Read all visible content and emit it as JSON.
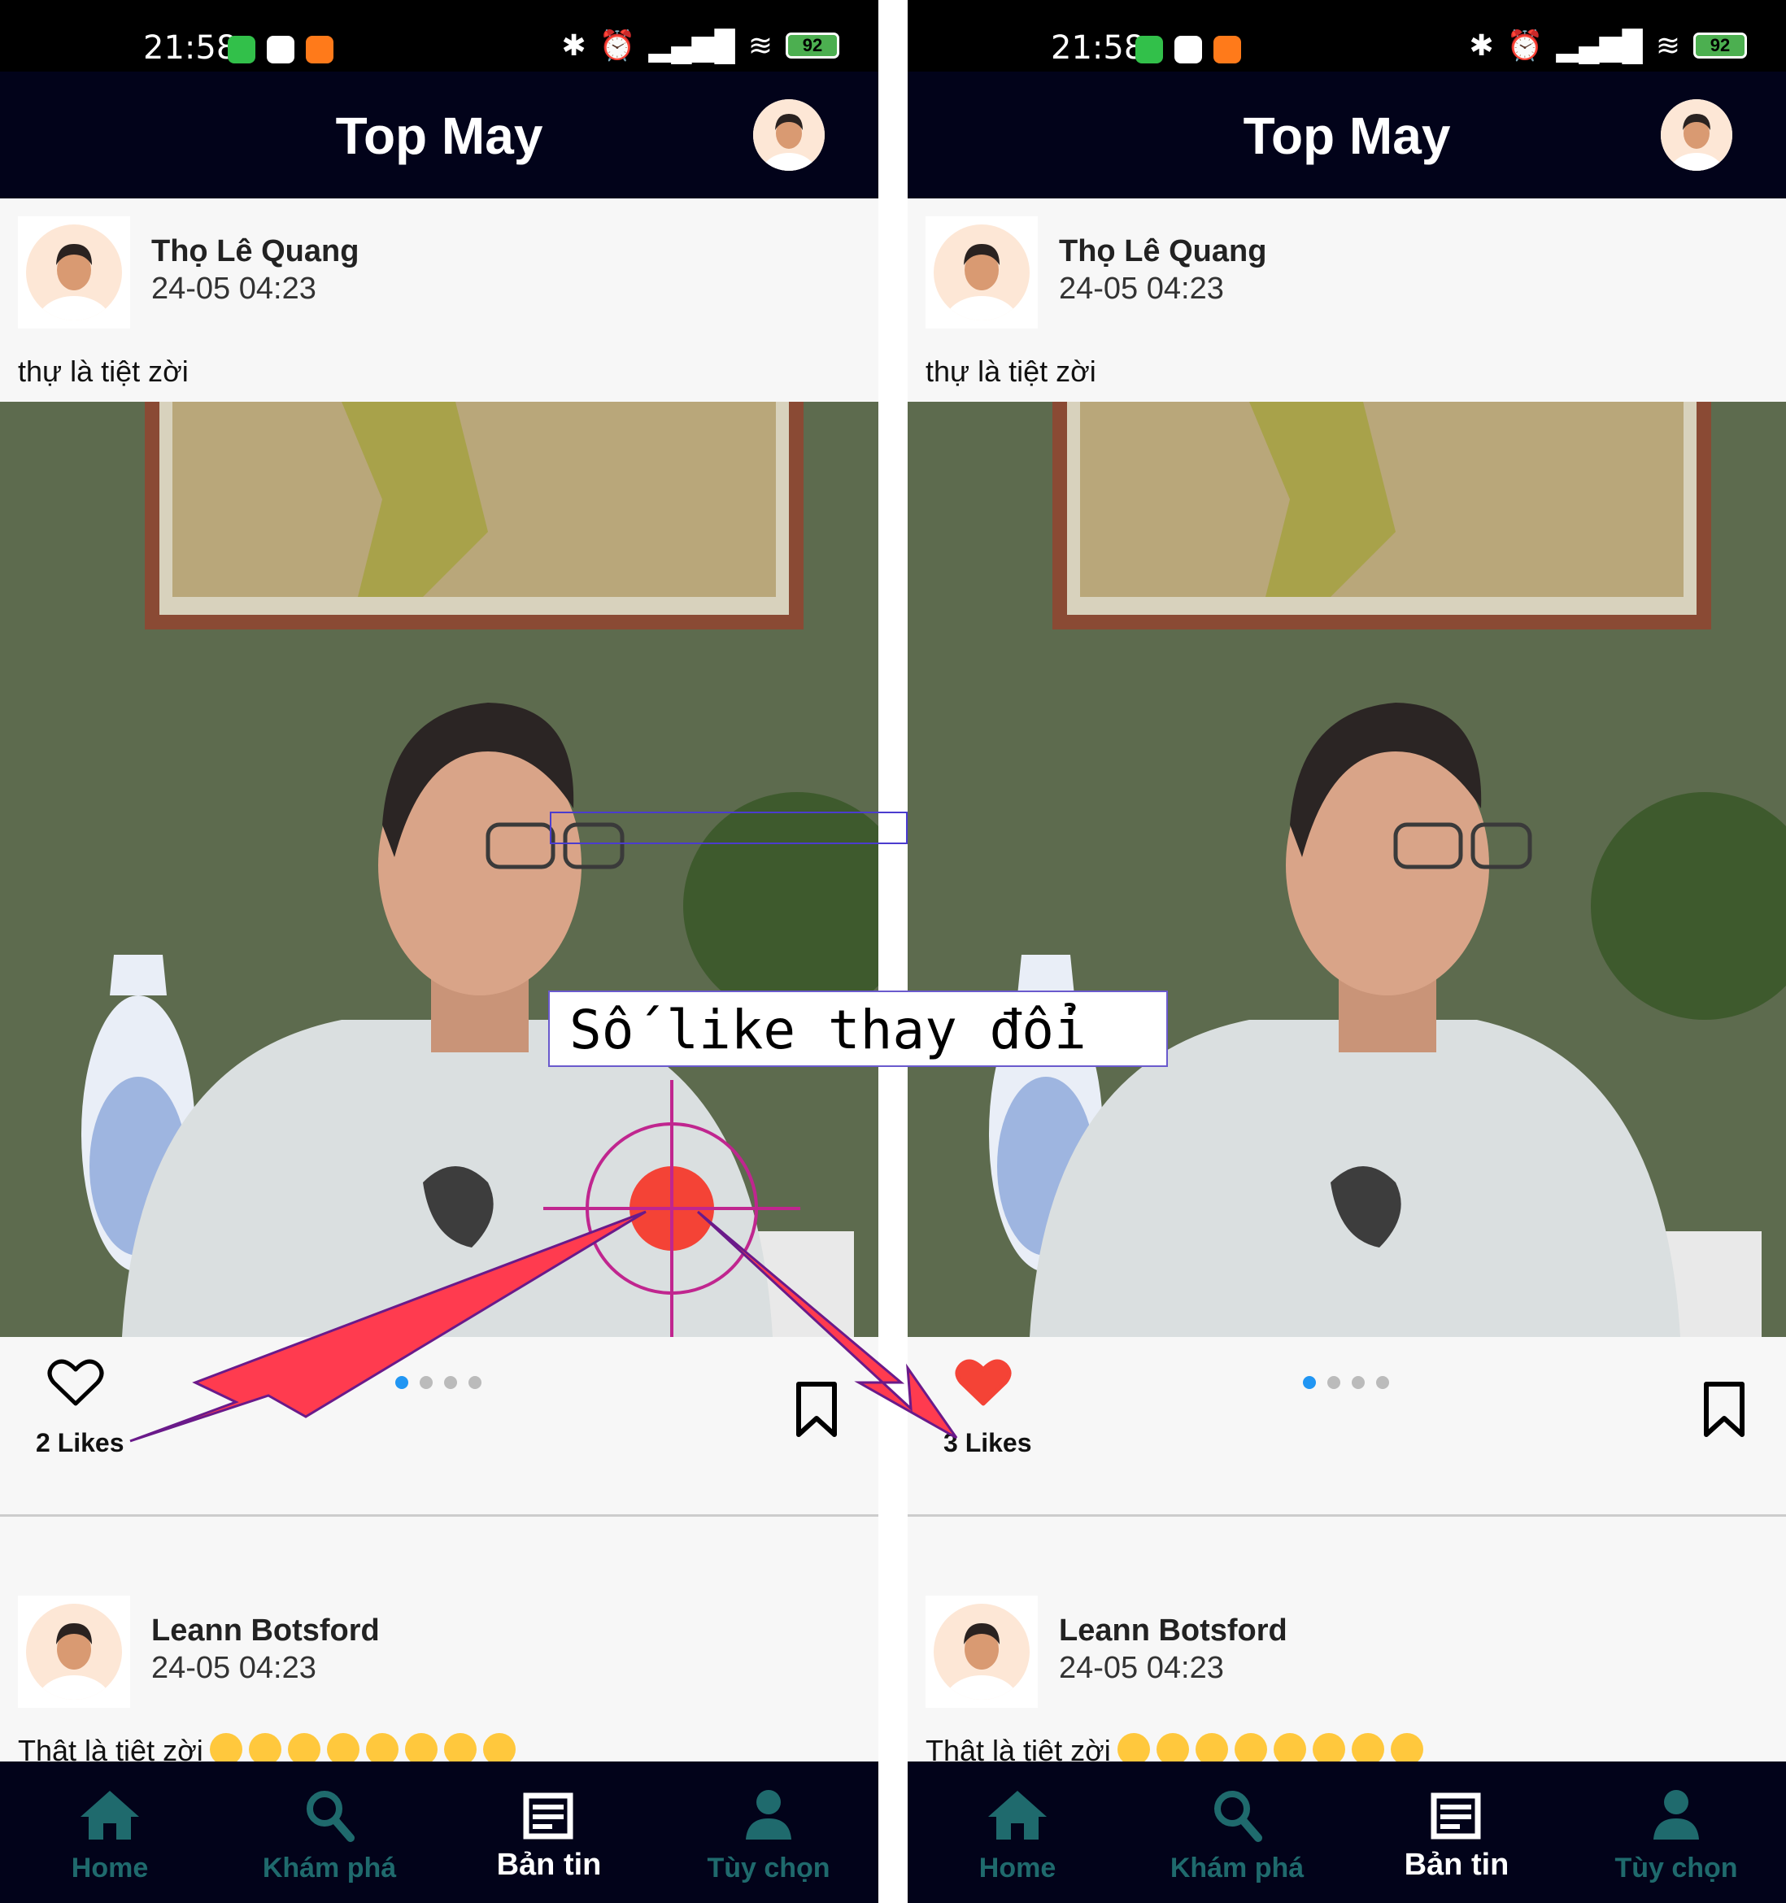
{
  "statusbar": {
    "time": "21:58",
    "battery": "92"
  },
  "app": {
    "title": "Top May"
  },
  "screens": [
    {
      "post1": {
        "author": "Thọ Lê Quang",
        "date": "24-05 04:23",
        "caption": "thự là tiệt zời",
        "likes": "2 Likes",
        "liked": false
      },
      "post2": {
        "author": "Leann Botsford",
        "date": "24-05 04:23",
        "caption": "Thật là tiệt zời"
      }
    },
    {
      "post1": {
        "author": "Thọ Lê Quang",
        "date": "24-05 04:23",
        "caption": "thự là tiệt zời",
        "likes": "3 Likes",
        "liked": true
      },
      "post2": {
        "author": "Leann Botsford",
        "date": "24-05 04:23",
        "caption": "Thật là tiệt zời"
      }
    }
  ],
  "nav": [
    {
      "label": "Home",
      "icon": "home-icon"
    },
    {
      "label": "Khám phá",
      "icon": "search-icon"
    },
    {
      "label": "Bản tin",
      "icon": "news-icon"
    },
    {
      "label": "Tùy chọn",
      "icon": "person-icon"
    }
  ],
  "annotation": {
    "text": "Số like thay đổi"
  },
  "colors": {
    "appbar": "#02031a",
    "liked_heart": "#f44336",
    "active_dot": "#2196f3",
    "arrow": "#ff3b4f"
  }
}
